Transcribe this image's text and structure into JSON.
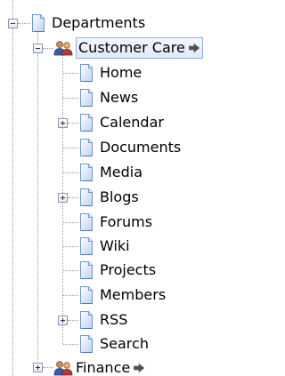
{
  "tree": {
    "root": {
      "label": "Departments",
      "icon": "page-icon",
      "expanded": true
    },
    "customer_care": {
      "label": "Customer Care",
      "icon": "group-icon",
      "expanded": true,
      "selected": true,
      "has_link_arrow": true
    },
    "children": [
      {
        "label": "Home",
        "icon": "page-icon",
        "expandable": false
      },
      {
        "label": "News",
        "icon": "page-icon",
        "expandable": false
      },
      {
        "label": "Calendar",
        "icon": "page-icon",
        "expandable": true
      },
      {
        "label": "Documents",
        "icon": "page-icon",
        "expandable": false
      },
      {
        "label": "Media",
        "icon": "page-icon",
        "expandable": false
      },
      {
        "label": "Blogs",
        "icon": "page-icon",
        "expandable": true
      },
      {
        "label": "Forums",
        "icon": "page-icon",
        "expandable": false
      },
      {
        "label": "Wiki",
        "icon": "page-icon",
        "expandable": false
      },
      {
        "label": "Projects",
        "icon": "page-icon",
        "expandable": false
      },
      {
        "label": "Members",
        "icon": "page-icon",
        "expandable": false
      },
      {
        "label": "RSS",
        "icon": "page-icon",
        "expandable": true
      },
      {
        "label": "Search",
        "icon": "page-icon",
        "expandable": false
      }
    ],
    "finance": {
      "label": "Finance",
      "icon": "group-icon",
      "expanded": false,
      "has_link_arrow": true
    }
  },
  "colors": {
    "selection_border": "#8fb0df",
    "selection_fill": "#dfe9f8",
    "tree_line": "#9a9a9a",
    "page_icon_blue": "#6f95cf"
  }
}
